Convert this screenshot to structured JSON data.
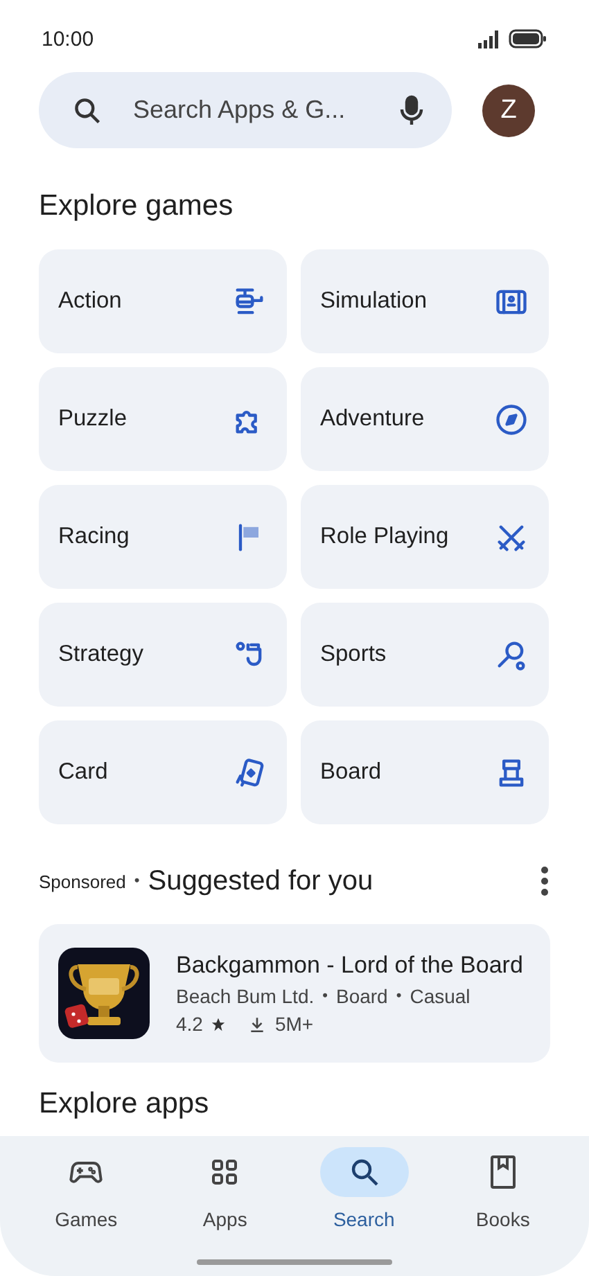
{
  "status_bar": {
    "time": "10:00"
  },
  "search": {
    "placeholder": "Search Apps & G..."
  },
  "account": {
    "initial": "Z"
  },
  "explore_games": {
    "title": "Explore games",
    "categories": [
      {
        "label": "Action"
      },
      {
        "label": "Simulation"
      },
      {
        "label": "Puzzle"
      },
      {
        "label": "Adventure"
      },
      {
        "label": "Racing"
      },
      {
        "label": "Role Playing"
      },
      {
        "label": "Strategy"
      },
      {
        "label": "Sports"
      },
      {
        "label": "Card"
      },
      {
        "label": "Board"
      }
    ]
  },
  "suggested": {
    "sponsored": "Sponsored",
    "separator": "•",
    "title": "Suggested for you",
    "app": {
      "name": "Backgammon - Lord of the Board",
      "developer": "Beach Bum Ltd.",
      "tags": [
        "Board",
        "Casual"
      ],
      "rating": "4.2",
      "downloads": "5M+"
    }
  },
  "next_section": {
    "title": "Explore apps"
  },
  "bottom_nav": [
    {
      "label": "Games",
      "selected": false
    },
    {
      "label": "Apps",
      "selected": false
    },
    {
      "label": "Search",
      "selected": true
    },
    {
      "label": "Books",
      "selected": false
    }
  ]
}
